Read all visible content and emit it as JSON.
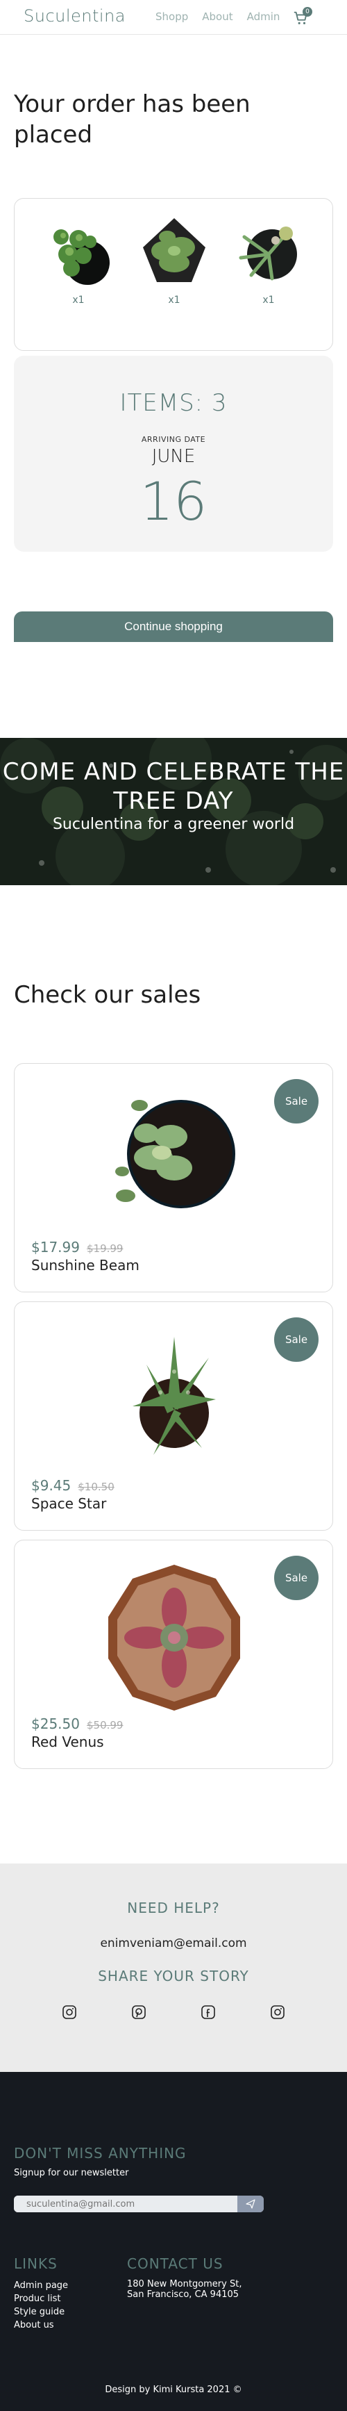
{
  "header": {
    "logo": "Suculentina",
    "nav": [
      "Shopp",
      "About",
      "Admin"
    ],
    "cart_count": "0"
  },
  "order": {
    "title": "Your order has been placed",
    "items": [
      {
        "qty": "x1"
      },
      {
        "qty": "x1"
      },
      {
        "qty": "x1"
      }
    ],
    "items_count": "ITEMS: 3",
    "arriving_label": "ARRIVING DATE",
    "arriving_month": "JUNE",
    "arriving_day": "16",
    "continue_label": "Continue shopping"
  },
  "banner": {
    "title": "COME AND CELEBRATE THE TREE DAY",
    "subtitle": "Suculentina for a greener world"
  },
  "sales": {
    "title": "Check our sales",
    "badge": "Sale",
    "products": [
      {
        "price": "$17.99",
        "old_price": "$19.99",
        "name": "Sunshine Beam"
      },
      {
        "price": "$9.45",
        "old_price": "$10.50",
        "name": "Space Star"
      },
      {
        "price": "$25.50",
        "old_price": "$50.99",
        "name": "Red Venus"
      }
    ]
  },
  "help": {
    "title": "NEED HELP?",
    "email": "enimveniam@email.com",
    "share_title": "SHARE YOUR STORY",
    "socials": [
      "instagram-icon",
      "pinterest-icon",
      "facebook-icon",
      "instagram-icon"
    ]
  },
  "footer": {
    "newsletter_title": "DON'T MISS ANYTHING",
    "newsletter_sub": "Signup for our newsletter",
    "newsletter_placeholder": "suculentina@gmail.com",
    "links_title": "LINKS",
    "links": [
      "Admin page",
      "Produc list",
      "Style guide",
      "About us"
    ],
    "contact_title": "CONTACT US",
    "contact_lines": [
      "180 New Montgomery St,",
      "San Francisco, CA 94105"
    ],
    "credit": "Design by Kimi Kursta 2021 ©"
  },
  "colors": {
    "accent": "#5b7b78",
    "footer_bg": "#161a20",
    "help_bg": "#ebebeb"
  }
}
